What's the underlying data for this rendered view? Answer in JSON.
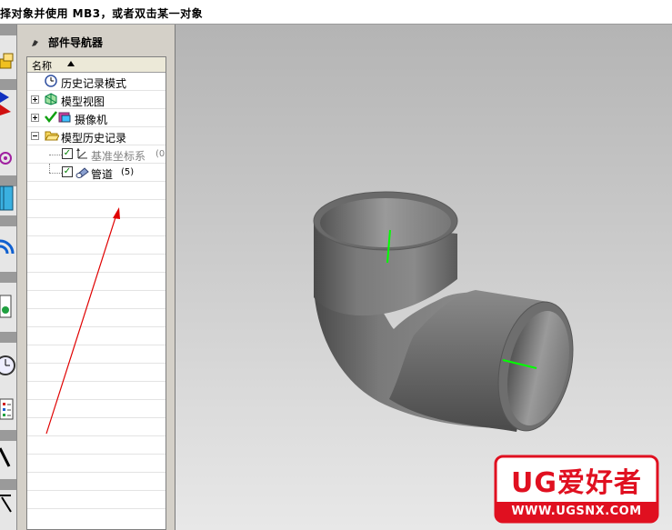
{
  "status_bar": {
    "text": "择对象并使用 MB3，或者双击某一对象"
  },
  "navigator": {
    "title": "部件导航器",
    "column_header": "名称",
    "items": [
      {
        "label": "历史记录模式",
        "icon": "clock-icon"
      },
      {
        "label": "模型视图",
        "icon": "model-views-icon",
        "expander": "+"
      },
      {
        "label": "摄像机",
        "icon": "camera-icon",
        "expander": "+"
      },
      {
        "label": "模型历史记录",
        "icon": "folder-open-icon",
        "expander": "-"
      },
      {
        "label": "基准坐标系",
        "suffix": "(0",
        "icon": "datum-csys-icon",
        "checked": true
      },
      {
        "label": "管道",
        "suffix": "(5)",
        "icon": "tube-feature-icon",
        "checked": true
      }
    ]
  },
  "watermark": {
    "logo_text": "UG爱好者",
    "url": "WWW.UGSNX.COM"
  },
  "colors": {
    "annotation_arrow": "#e00000",
    "axis_line": "#00ff00",
    "part_gray": "#6e6e6e",
    "watermark_red": "#e01020"
  }
}
